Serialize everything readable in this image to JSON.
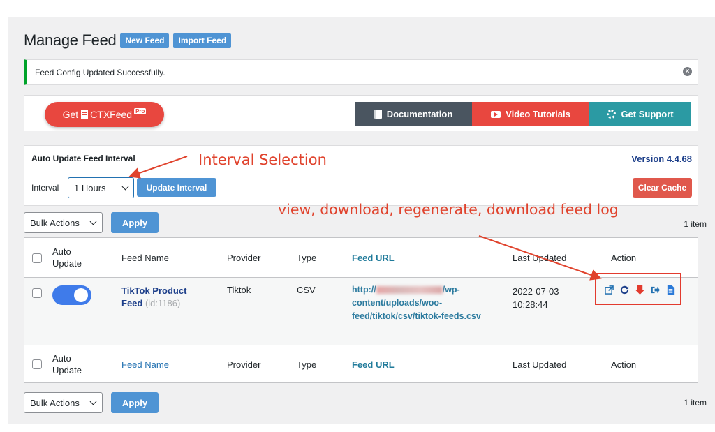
{
  "header": {
    "title": "Manage Feed",
    "new_feed": "New Feed",
    "import_feed": "Import Feed"
  },
  "notice": {
    "text": "Feed Config Updated Successfully.",
    "dismiss_icon": "×"
  },
  "promo": {
    "get_prefix": "Get",
    "brand": "CTXFeed",
    "pro": "Pro",
    "documentation": "Documentation",
    "video_tutorials": "Video Tutorials",
    "get_support": "Get Support"
  },
  "interval_panel": {
    "heading": "Auto Update Feed Interval",
    "version": "Version 4.4.68",
    "label": "Interval",
    "selected": "1 Hours",
    "update_button": "Update Interval",
    "clear_cache": "Clear Cache"
  },
  "bulk": {
    "select": "Bulk Actions",
    "apply": "Apply",
    "count": "1 item"
  },
  "table": {
    "headers": {
      "auto_line1": "Auto",
      "auto_line2": "Update",
      "feed_name": "Feed Name",
      "provider": "Provider",
      "type": "Type",
      "feed_url": "Feed URL",
      "last_updated": "Last Updated",
      "action": "Action"
    },
    "rows": [
      {
        "auto_update": true,
        "name_line1": "TikTok Product",
        "name_line2": "Feed",
        "id": "(id:1186)",
        "provider": "Tiktok",
        "type": "CSV",
        "url_prefix": "http://",
        "url_suffix": "/wp-",
        "url_line2": "content/uploads/woo-",
        "url_line3": "feed/tiktok/csv/tiktok-feeds.csv",
        "date": "2022-07-03",
        "time": "10:28:44",
        "actions": [
          "view-icon",
          "regenerate-icon",
          "download-icon",
          "download-log-icon",
          "document-icon"
        ]
      }
    ]
  },
  "annotations": {
    "interval": "Interval Selection",
    "actions": "view, download, regenerate, download feed log"
  },
  "colors": {
    "primary": "#4f94d4",
    "danger": "#e8473f",
    "annotation": "#e0432d",
    "toggle": "#3f7bea"
  }
}
